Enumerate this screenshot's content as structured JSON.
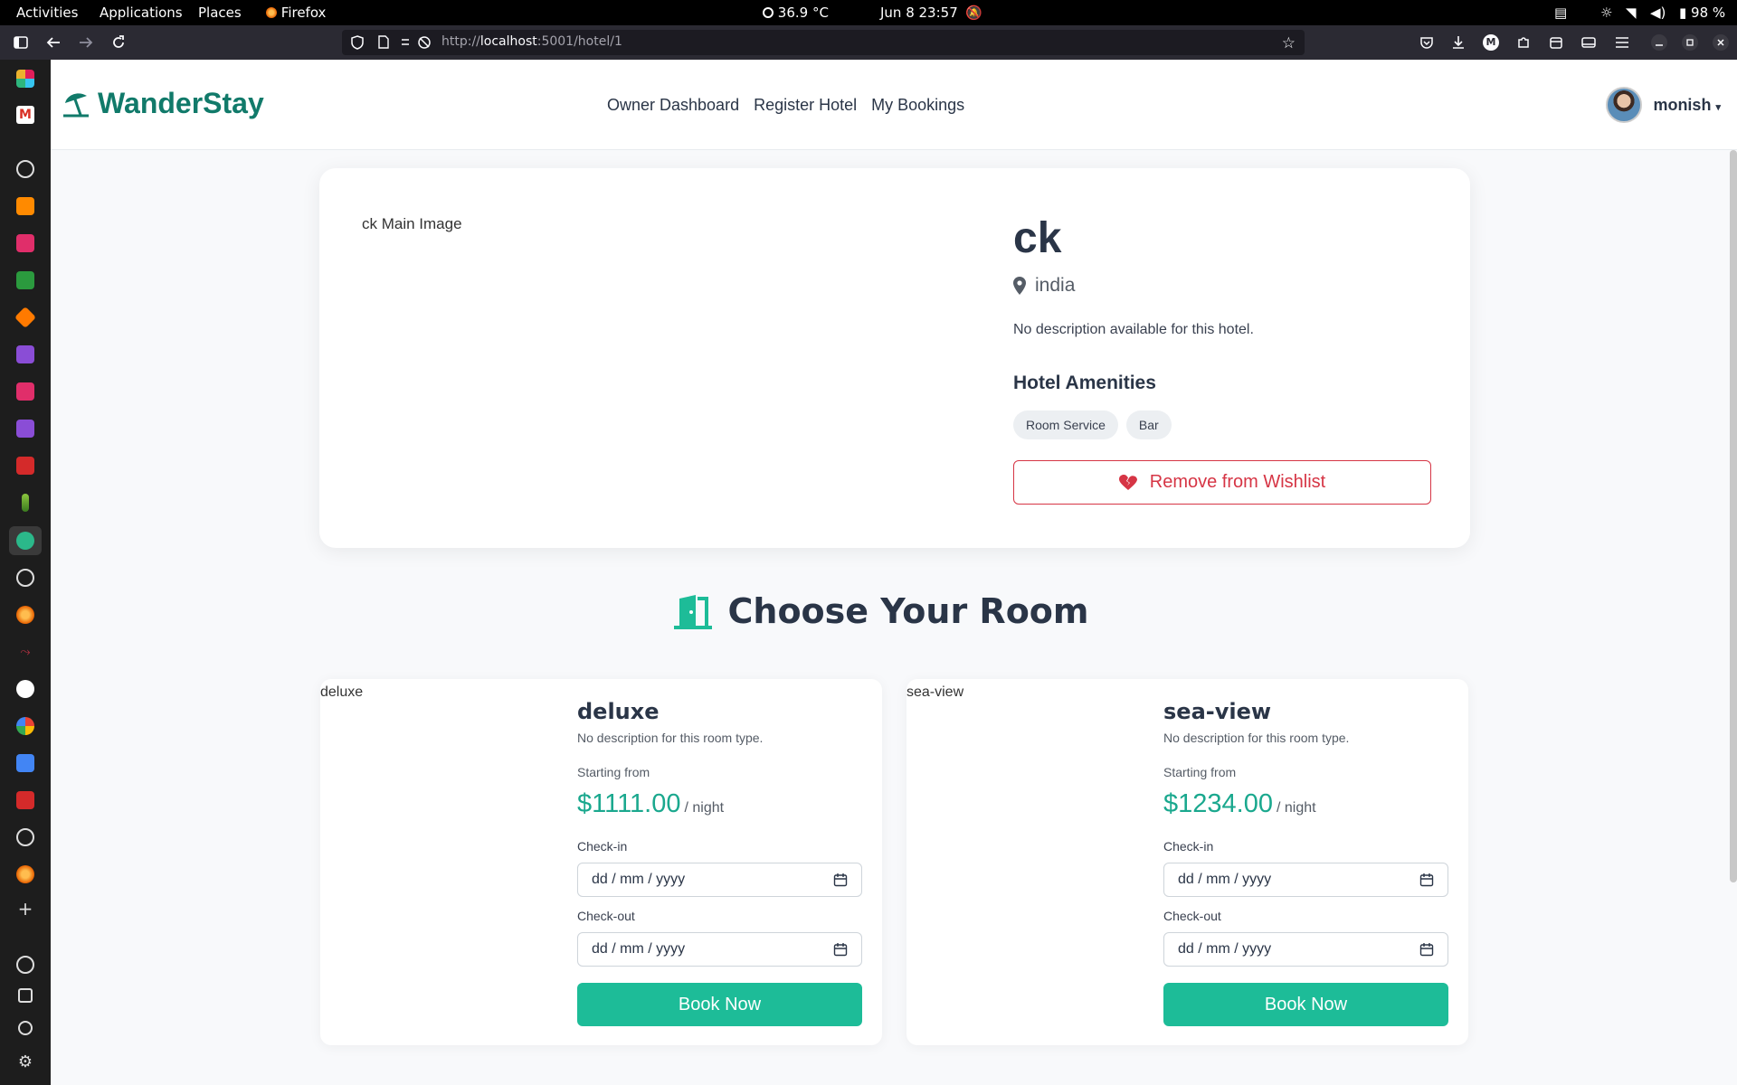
{
  "system": {
    "activities": "Activities",
    "applications": "Applications",
    "places": "Places",
    "app_name": "Firefox",
    "temperature": "36.9 °C",
    "datetime": "Jun 8  23:57",
    "battery": "98 %"
  },
  "browser": {
    "url_prefix": "http://",
    "url_host": "localhost",
    "url_rest": ":5001/hotel/1"
  },
  "navbar": {
    "brand": "WanderStay",
    "links": [
      "Owner Dashboard",
      "Register Hotel",
      "My Bookings"
    ],
    "username": "monish"
  },
  "hotel": {
    "image_alt": "ck Main Image",
    "name": "ck",
    "location": "india",
    "description": "No description available for this hotel.",
    "amenities_title": "Hotel Amenities",
    "amenities": [
      "Room Service",
      "Bar"
    ],
    "wishlist_button": "Remove from Wishlist"
  },
  "rooms_section": {
    "title": "Choose Your Room"
  },
  "rooms": [
    {
      "image_alt": "deluxe",
      "name": "deluxe",
      "description": "No description for this room type.",
      "starting_from": "Starting from",
      "price": "$1111.00",
      "unit": "/ night",
      "checkin_label": "Check-in",
      "checkin_placeholder": "dd / mm / yyyy",
      "checkout_label": "Check-out",
      "checkout_placeholder": "dd / mm / yyyy",
      "button": "Book Now"
    },
    {
      "image_alt": "sea-view",
      "name": "sea-view",
      "description": "No description for this room type.",
      "starting_from": "Starting from",
      "price": "$1234.00",
      "unit": "/ night",
      "checkin_label": "Check-in",
      "checkin_placeholder": "dd / mm / yyyy",
      "checkout_label": "Check-out",
      "checkout_placeholder": "dd / mm / yyyy",
      "button": "Book Now"
    }
  ],
  "colors": {
    "brand": "#117a6a",
    "accent": "#1dbc98",
    "price": "#1aa88e",
    "danger": "#d63545"
  }
}
